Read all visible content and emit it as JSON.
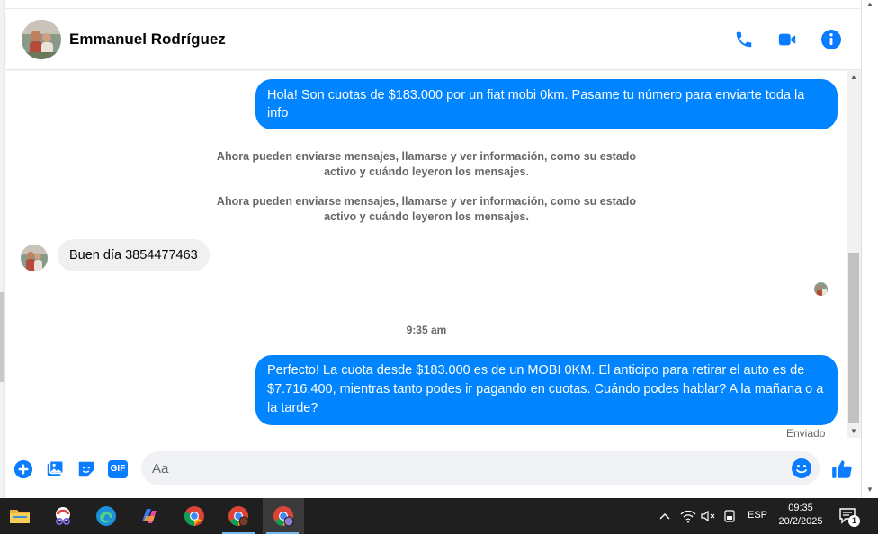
{
  "header": {
    "contact_name": "Emmanuel Rodríguez",
    "actions": [
      "phone-icon",
      "video-icon",
      "info-icon"
    ]
  },
  "messages": {
    "out_1": "Hola! Son cuotas de $183.000 por un fiat mobi 0km. Pasame tu número para enviarte toda la info",
    "system_1": "Ahora pueden enviarse mensajes, llamarse y ver información, como su estado activo y cuándo leyeron los mensajes.",
    "system_2": "Ahora pueden enviarse mensajes, llamarse y ver información, como su estado activo y cuándo leyeron los mensajes.",
    "in_1": "Buen día 3854477463",
    "timestamp": "9:35 am",
    "out_2": "Perfecto! La cuota desde $183.000 es de un MOBI 0KM. El anticipo para retirar el auto es de $7.716.400, mientras tanto podes ir pagando en cuotas. Cuándo podes hablar? A la mañana o a la tarde?",
    "status": "Enviado"
  },
  "composer": {
    "placeholder": "Aa",
    "left_icons": [
      "plus-icon",
      "image-icon",
      "sticker-icon",
      "gif-icon"
    ],
    "gif_label": "GIF"
  },
  "taskbar": {
    "language": "ESP",
    "time": "09:35",
    "date": "20/2/2025",
    "notification_count": "1"
  },
  "colors": {
    "messenger_blue": "#0084ff",
    "taskbar": "#1f1f1f"
  }
}
